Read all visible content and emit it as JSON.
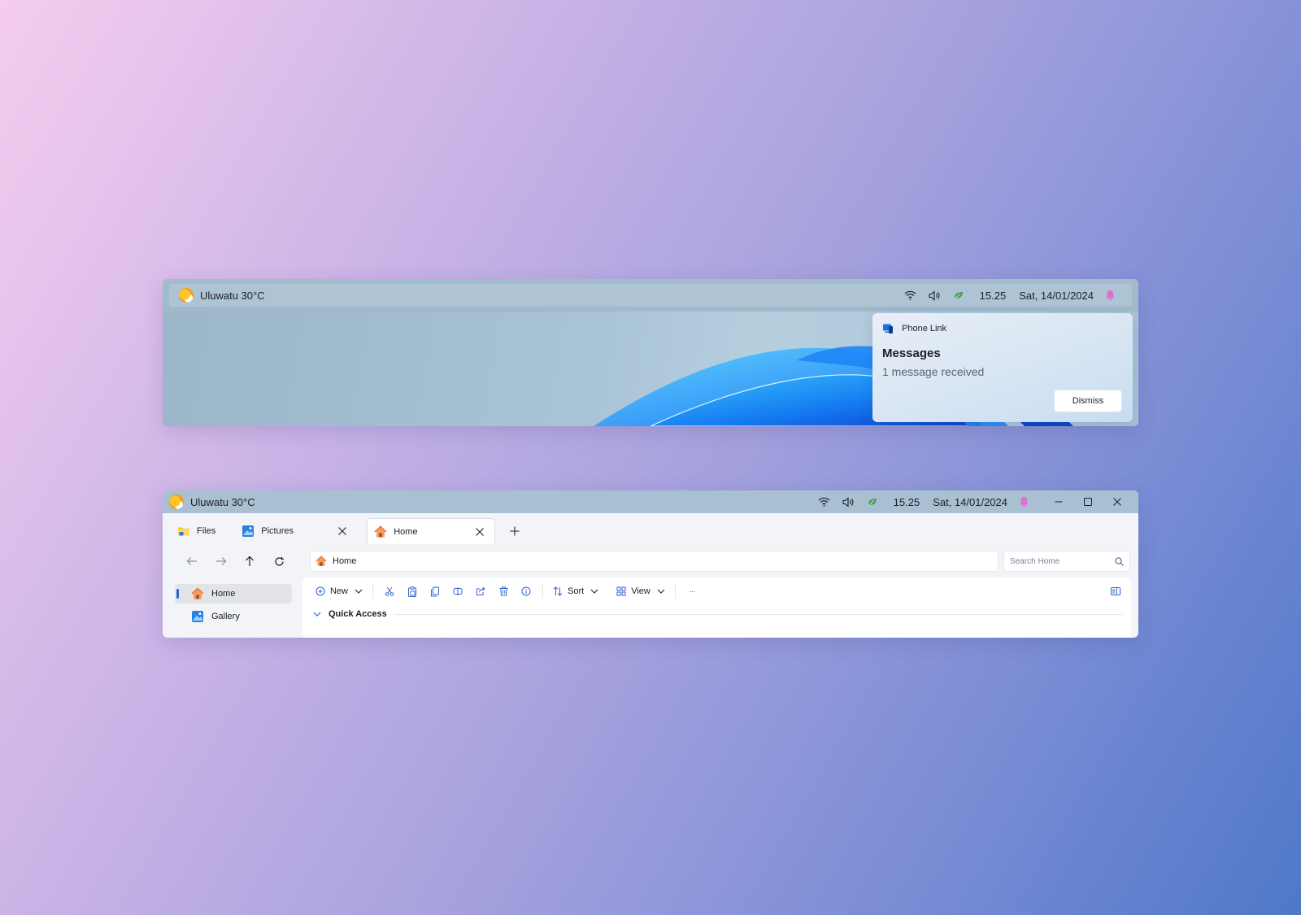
{
  "taskbar": {
    "weather": "Uluwatu 30°C",
    "time": "15.25",
    "date": "Sat, 14/01/2024",
    "icons": [
      "wifi-icon",
      "volume-icon",
      "battery-icon",
      "bell-icon"
    ]
  },
  "notification": {
    "app_name": "Phone Link",
    "title": "Messages",
    "body": "1 message received",
    "dismiss_label": "Dismiss"
  },
  "explorer": {
    "tabs": [
      {
        "label": "Files",
        "icon": "folder-icon"
      },
      {
        "label": "Pictures",
        "icon": "pictures-icon"
      },
      {
        "label": "Home",
        "icon": "home-icon",
        "active": true
      }
    ],
    "address": "Home",
    "search_placeholder": "Search Home",
    "commands": {
      "new_label": "New",
      "sort_label": "Sort",
      "view_label": "View",
      "more_label": "···"
    },
    "sidebar": [
      {
        "label": "Home",
        "icon": "home-icon",
        "selected": true
      },
      {
        "label": "Gallery",
        "icon": "gallery-icon"
      }
    ],
    "section_title": "Quick Access"
  },
  "colors": {
    "accent": "#2f64d6",
    "notification_bell": "#e46bd4",
    "battery": "#4f9a5a"
  }
}
